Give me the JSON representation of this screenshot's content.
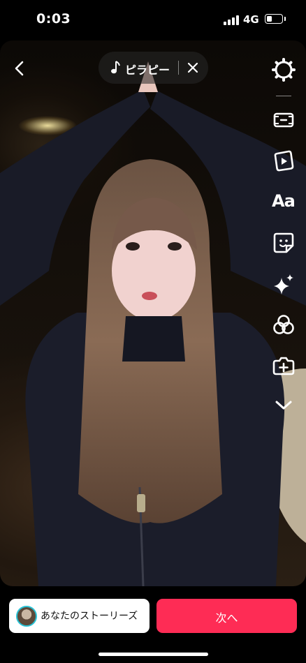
{
  "status_bar": {
    "time": "0:03",
    "network": "4G",
    "battery_level": 0.35
  },
  "music": {
    "title": "ピラピー"
  },
  "toolbar": {
    "icons": [
      "settings-gear-icon",
      "flip-frame-icon",
      "video-template-icon",
      "text-icon",
      "sticker-icon",
      "effects-sparkle-icon",
      "filters-icon",
      "add-clip-icon",
      "more-chevron-down-icon"
    ],
    "text_label": "Aa"
  },
  "footer": {
    "story_label": "あなたのストーリーズ",
    "next_label": "次へ"
  },
  "colors": {
    "next": "#fe2c55",
    "story_ring": "#29c3d6"
  }
}
